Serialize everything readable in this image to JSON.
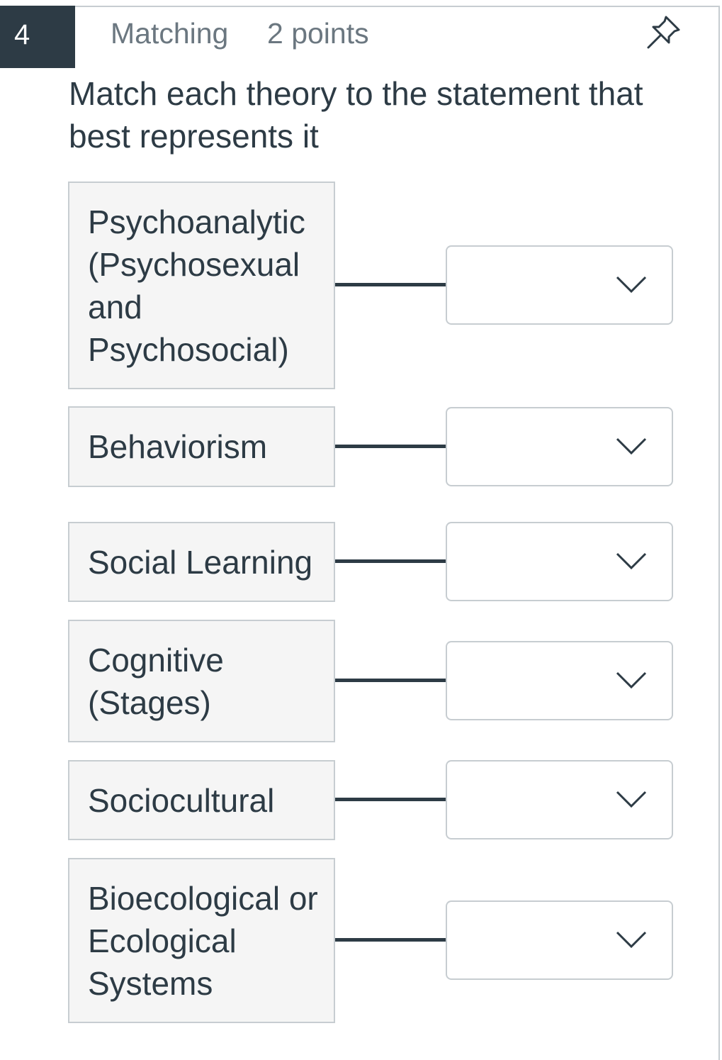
{
  "question": {
    "number": "4",
    "type": "Matching",
    "points": "2 points",
    "prompt": "Match each theory to the statement that best represents it",
    "pin_icon": "pin-icon"
  },
  "matches": [
    {
      "term": "Psychoanalytic (Psychosexual and Psychosocial)",
      "selected": ""
    },
    {
      "term": "Behaviorism",
      "selected": ""
    },
    {
      "term": "Social Learning",
      "selected": ""
    },
    {
      "term": "Cognitive (Stages)",
      "selected": ""
    },
    {
      "term": "Sociocultural",
      "selected": ""
    },
    {
      "term": "Bioecological or Ecological Systems",
      "selected": ""
    }
  ],
  "colors": {
    "badge": "#2d3b45",
    "text": "#2d3b45",
    "muted": "#6b7780",
    "border": "#c7cdd1",
    "term_bg": "#f5f5f5"
  }
}
